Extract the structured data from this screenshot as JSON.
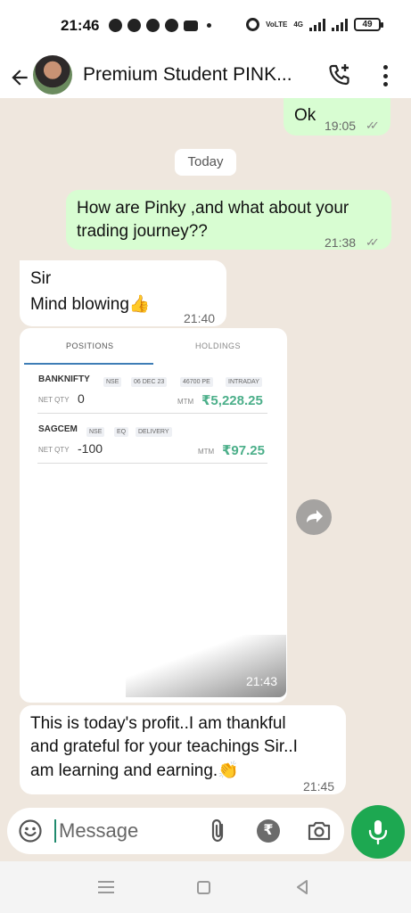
{
  "status_bar": {
    "time": "21:46",
    "icons": [
      "b-icon",
      "whatsapp-icon",
      "paw-icon",
      "contact-icon",
      "amazon-icon",
      "dot"
    ],
    "right_icons": [
      "alarm-icon",
      "volte-icon",
      "4g-signal-icon",
      "signal-icon"
    ],
    "volte_text": "VoLTE",
    "net_text": "4G",
    "battery": "49"
  },
  "header": {
    "title": "Premium Student PINK...",
    "icons": [
      "back-arrow-icon",
      "avatar",
      "add-call-icon",
      "more-vert-icon"
    ]
  },
  "chat": {
    "date_separator": "Today",
    "messages": [
      {
        "id": "m1",
        "direction": "out",
        "text": "Ok",
        "time": "19:05",
        "status": "read"
      },
      {
        "id": "m2",
        "direction": "out",
        "text_line1": "How are Pinky ,and what about your",
        "text_line2": "trading journey??",
        "time": "21:38",
        "status": "read"
      },
      {
        "id": "m3",
        "direction": "in",
        "text_line1": "Sir",
        "text_line2": "Mind blowing👍",
        "time": "21:40"
      },
      {
        "id": "m4",
        "direction": "in",
        "type": "image",
        "time": "21:43"
      },
      {
        "id": "m5",
        "direction": "in",
        "text_line1": "This is today's profit..I am thankful",
        "text_line2": "and grateful for your teachings Sir..I",
        "text_line3": "am learning and earning.👏",
        "time": "21:45"
      }
    ]
  },
  "image_content": {
    "tabs": {
      "positions": "POSITIONS",
      "holdings": "HOLDINGS"
    },
    "positions": [
      {
        "symbol": "BANKNIFTY",
        "tags": [
          "NSE",
          "06 DEC 23",
          "46700 PE",
          "INTRADAY"
        ],
        "net_qty_label": "NET QTY",
        "net_qty": "0",
        "mtm_label": "MTM",
        "mtm": "₹5,228.25"
      },
      {
        "symbol": "SAGCEM",
        "tags": [
          "NSE",
          "EQ",
          "DELIVERY"
        ],
        "net_qty_label": "NET QTY",
        "net_qty": "-100",
        "mtm_label": "MTM",
        "mtm": "₹97.25"
      }
    ]
  },
  "input": {
    "placeholder": "Message",
    "icons": [
      "emoji-icon",
      "attach-icon",
      "rupee-payment-icon",
      "camera-icon",
      "mic-icon"
    ]
  },
  "colors": {
    "outgoing_bubble": "#d8fdd2",
    "incoming_bubble": "#ffffff",
    "chat_background": "#efe7de",
    "accent_green": "#1da851",
    "profit_green": "#4caf8a"
  }
}
